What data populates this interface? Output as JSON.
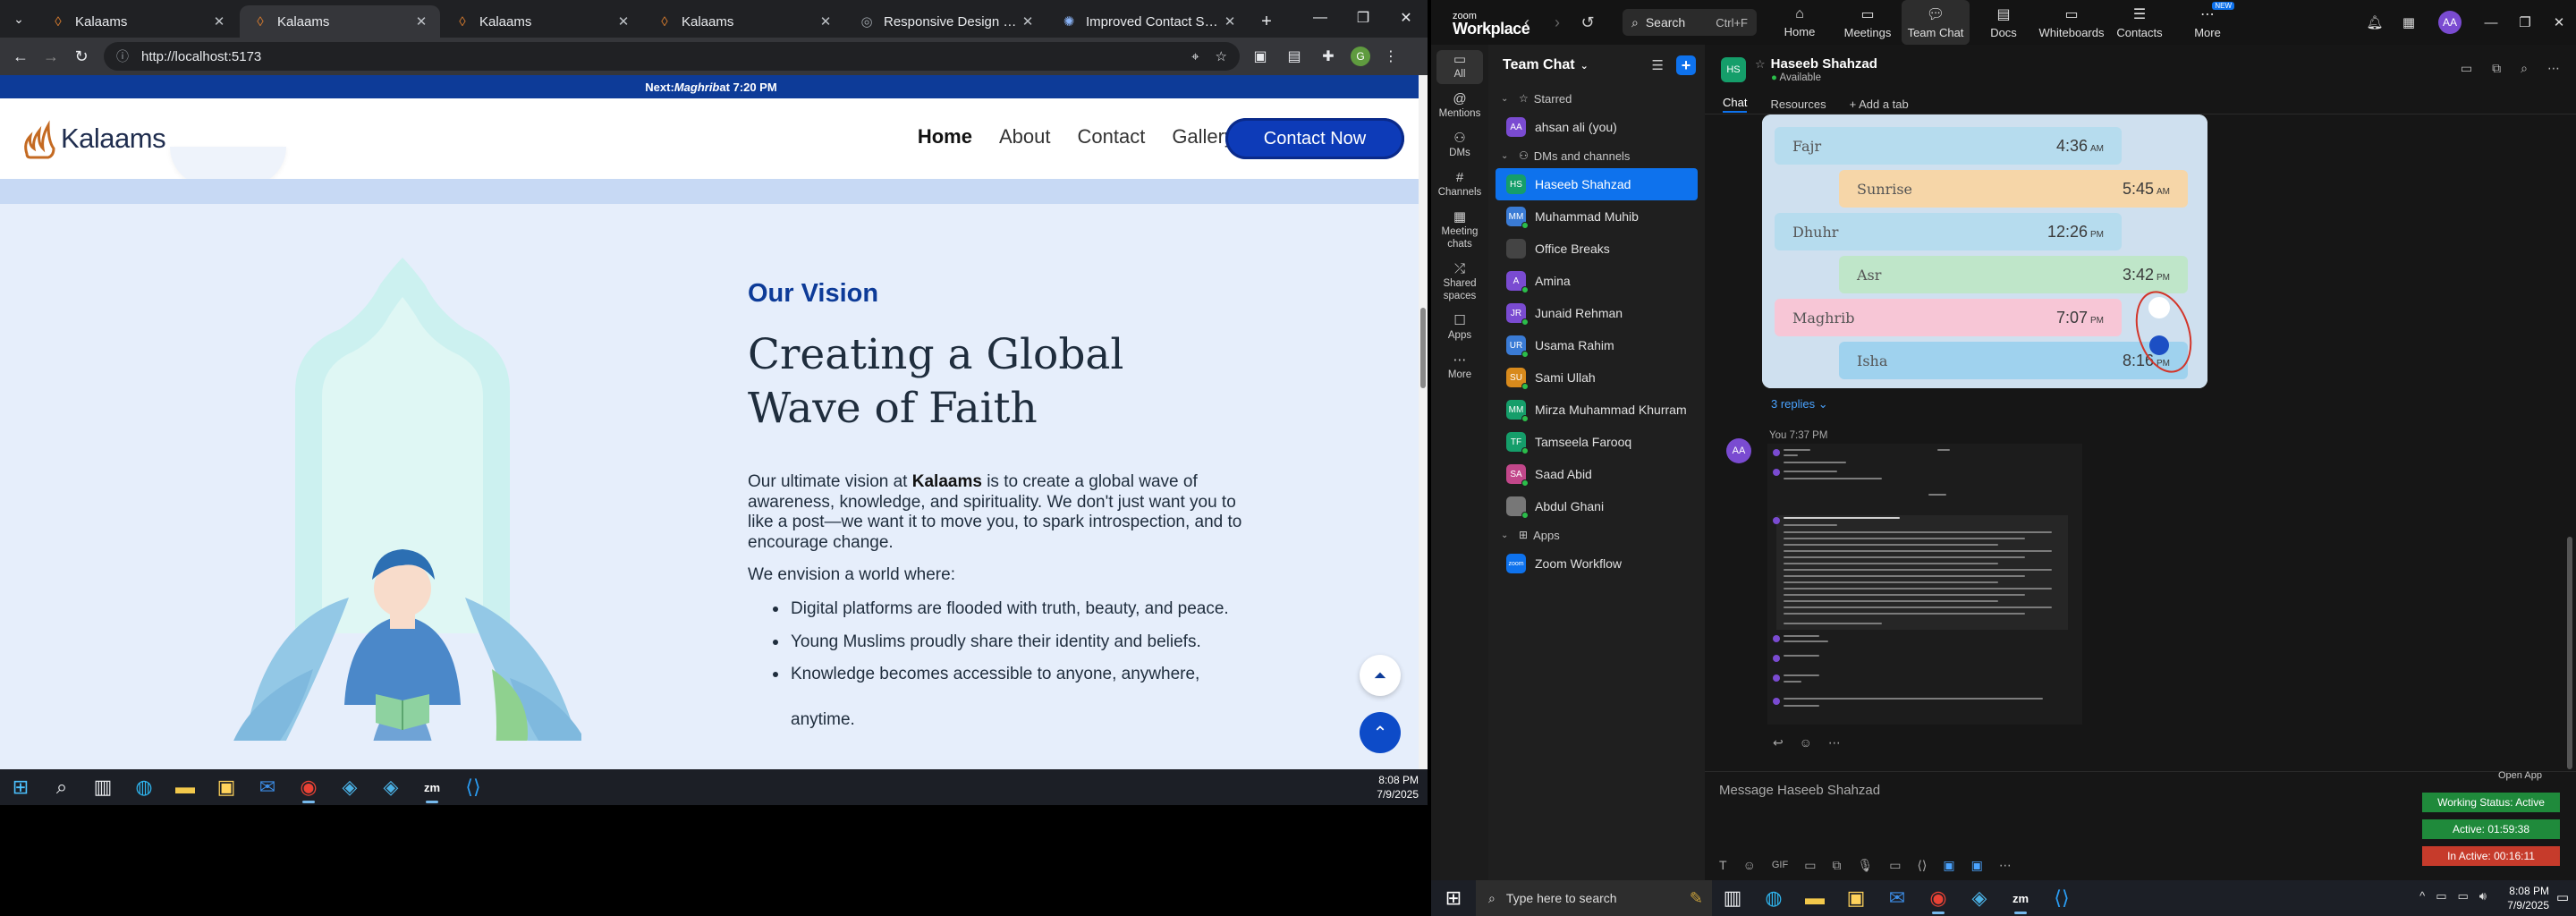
{
  "browser": {
    "tabs": [
      {
        "title": "Kalaams",
        "favicon": "kalaams-icon",
        "active": false
      },
      {
        "title": "Kalaams",
        "favicon": "kalaams-icon",
        "active": true
      },
      {
        "title": "Kalaams",
        "favicon": "kalaams-icon",
        "active": false
      },
      {
        "title": "Kalaams",
        "favicon": "kalaams-icon",
        "active": false
      },
      {
        "title": "Responsive Design for Conta",
        "favicon": "globe-icon",
        "active": false
      },
      {
        "title": "Improved Contact Section St",
        "favicon": "chatgpt-icon",
        "active": false
      }
    ],
    "url": "http://localhost:5173"
  },
  "site": {
    "prayer_banner_prefix": "Next: ",
    "prayer_banner_name": "Maghrib",
    "prayer_banner_suffix": " at 7:20 PM",
    "logo_text": "Kalaams",
    "nav": [
      "Home",
      "About",
      "Contact",
      "Gallery"
    ],
    "cta_label": "Contact Now",
    "vision_label": "Our Vision",
    "vision_title": "Creating a Global Wave of Faith",
    "vision_p_before": "Our ultimate vision at ",
    "vision_p_brand": "Kalaams",
    "vision_p_after": " is to create a global wave of awareness, knowledge, and spirituality. We don't just want you to like a post—we want it to move you, to spark introspection, and to encourage change.",
    "envision_intro": "We envision a world where:",
    "envision_items": [
      "Digital platforms are flooded with truth, beauty, and peace.",
      "Young Muslims proudly share their identity and beliefs.",
      "Knowledge becomes accessible to anyone, anywhere,",
      "anytime."
    ],
    "colors": {
      "primary": "#0d3b98",
      "background": "#e6eefb"
    }
  },
  "taskbar_left": {
    "time": "8:08 PM",
    "date": "7/9/2025"
  },
  "zoom": {
    "logo_small": "zoom",
    "logo_big": "Workplace",
    "search_label": "Search",
    "search_shortcut": "Ctrl+F",
    "nav": [
      {
        "label": "Home",
        "icon": "home-icon",
        "active": false
      },
      {
        "label": "Meetings",
        "icon": "video-icon",
        "active": false
      },
      {
        "label": "Team Chat",
        "icon": "chat-icon",
        "active": true
      },
      {
        "label": "Docs",
        "icon": "doc-icon",
        "active": false
      },
      {
        "label": "Whiteboards",
        "icon": "whiteboard-icon",
        "active": false
      },
      {
        "label": "Contacts",
        "icon": "contacts-icon",
        "active": false
      },
      {
        "label": "More",
        "icon": "more-icon",
        "active": false,
        "badge": "NEW"
      }
    ],
    "user_initials": "AA",
    "rail": [
      {
        "label": "All",
        "icon": "chat-bubble-icon",
        "active": true
      },
      {
        "label": "Mentions",
        "icon": "at-icon",
        "active": false
      },
      {
        "label": "DMs",
        "icon": "people-icon",
        "active": false
      },
      {
        "label": "Channels",
        "icon": "hash-icon",
        "active": false
      },
      {
        "label": "Meeting chats",
        "icon": "calendar-icon",
        "active": false
      },
      {
        "label": "Shared spaces",
        "icon": "shared-icon",
        "active": false
      },
      {
        "label": "Apps",
        "icon": "apps-icon",
        "active": false
      },
      {
        "label": "More",
        "icon": "ellipsis-icon",
        "active": false
      }
    ],
    "list_title": "Team Chat",
    "groups": {
      "starred": "Starred",
      "dms": "DMs and channels",
      "apps": "Apps"
    },
    "starred_items": [
      {
        "name": "ahsan ali (you)",
        "initials": "AA",
        "color": "#7a4bd1"
      }
    ],
    "dm_items": [
      {
        "name": "Haseeb Shahzad",
        "initials": "HS",
        "color": "#159e6a",
        "active": true,
        "online": false
      },
      {
        "name": "Muhammad Muhib",
        "initials": "MM",
        "color": "#3a7bd5",
        "active": false,
        "online": true
      },
      {
        "name": "Office Breaks",
        "initials": "",
        "color": "#444444",
        "active": false,
        "online": false
      },
      {
        "name": "Amina",
        "initials": "A",
        "color": "#7a4bd1",
        "active": false,
        "online": true
      },
      {
        "name": "Junaid Rehman",
        "initials": "JR",
        "color": "#7a4bd1",
        "active": false,
        "online": true
      },
      {
        "name": "Usama Rahim",
        "initials": "UR",
        "color": "#3a7bd5",
        "active": false,
        "online": true
      },
      {
        "name": "Sami Ullah",
        "initials": "SU",
        "color": "#d88a1c",
        "active": false,
        "online": true
      },
      {
        "name": "Mirza Muhammad Khurram",
        "initials": "MM",
        "color": "#159e6a",
        "active": false,
        "online": true
      },
      {
        "name": "Tamseela Farooq",
        "initials": "TF",
        "color": "#159e6a",
        "active": false,
        "online": true
      },
      {
        "name": "Saad Abid",
        "initials": "SA",
        "color": "#c2478a",
        "active": false,
        "online": true
      },
      {
        "name": "Abdul Ghani",
        "initials": "",
        "color": "#777777",
        "active": false,
        "online": true
      }
    ],
    "app_items": [
      {
        "name": "Zoom Workflow",
        "initials": "zoom",
        "color": "#0e72ed"
      }
    ],
    "chat": {
      "name": "Haseeb Shahzad",
      "initials": "HS",
      "status": "Available",
      "tabs": [
        "Chat",
        "Resources",
        "+ Add a tab"
      ],
      "prayer_rows": [
        {
          "name": "Fajr",
          "time": "4:36",
          "suffix": "AM",
          "color": "#b6dcee"
        },
        {
          "name": "Sunrise",
          "time": "5:45",
          "suffix": "AM",
          "color": "#f6d6a8"
        },
        {
          "name": "Dhuhr",
          "time": "12:26",
          "suffix": "PM",
          "color": "#b6dcee"
        },
        {
          "name": "Asr",
          "time": "3:42",
          "suffix": "PM",
          "color": "#bfe6c9"
        },
        {
          "name": "Maghrib",
          "time": "7:07",
          "suffix": "PM",
          "color": "#f7c6d6"
        },
        {
          "name": "Isha",
          "time": "8:16",
          "suffix": "PM",
          "color": "#9fd2ee"
        }
      ],
      "replies": "3 replies",
      "message_sender": "You",
      "message_time": "7:37 PM",
      "composer_placeholder": "Message Haseeb Shahzad"
    },
    "open_app": "Open App",
    "working_status": "Working Status: Active",
    "active_time": "Active: 01:59:38",
    "inactive_time": "In Active: 00:16:11"
  },
  "taskbar_right": {
    "search_placeholder": "Type here to search",
    "time": "8:08 PM",
    "date": "7/9/2025"
  }
}
